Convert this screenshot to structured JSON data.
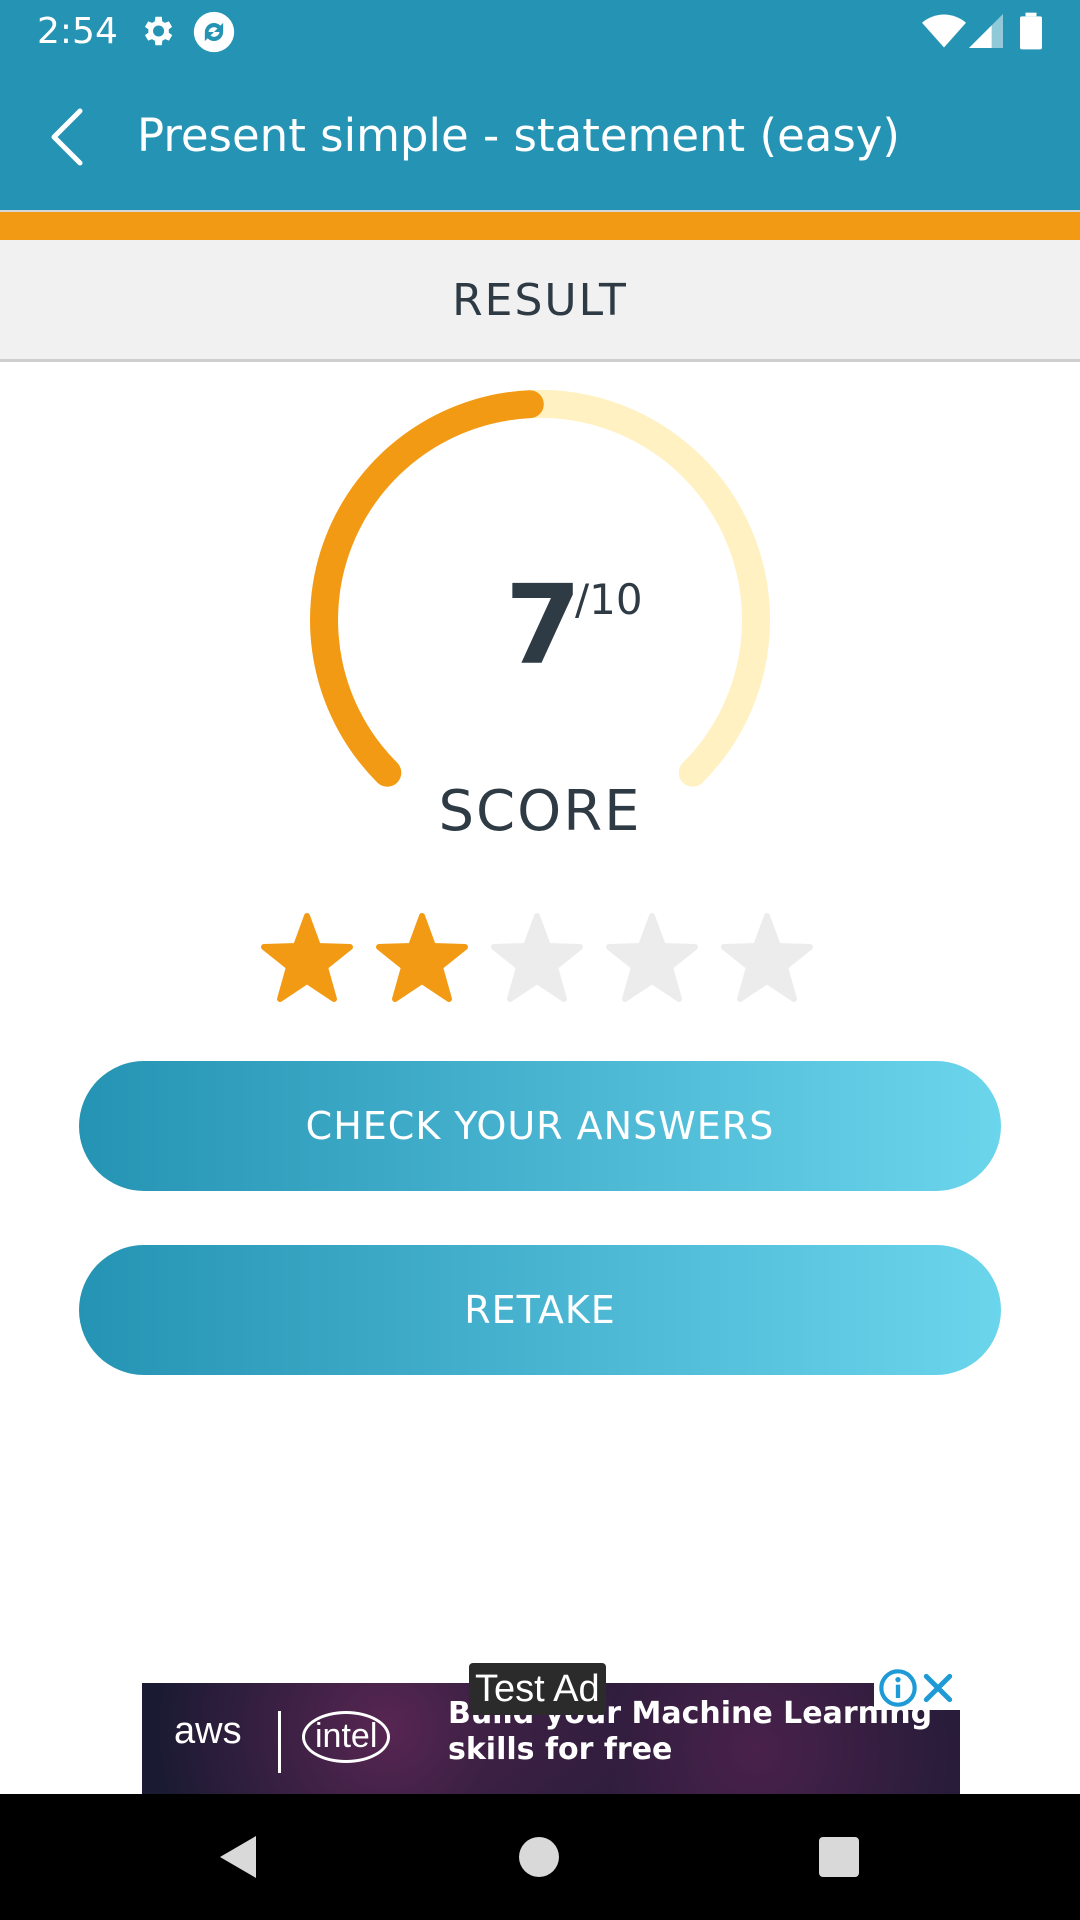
{
  "status_bar": {
    "time": "2:54",
    "icons": [
      "gear-icon",
      "sync-app-icon",
      "wifi-icon",
      "cell-signal-icon",
      "battery-icon"
    ]
  },
  "app_bar": {
    "back_icon": "chevron-left-icon",
    "title": "Present simple - statement (easy)"
  },
  "section": {
    "label": "RESULT"
  },
  "score": {
    "value": "7",
    "total": "/10",
    "label": "SCORE",
    "fraction": 0.7
  },
  "rating": {
    "filled": 2,
    "total": 5
  },
  "buttons": {
    "check_answers": "CHECK YOUR ANSWERS",
    "retake": "RETAKE"
  },
  "ad": {
    "badge": "Test Ad",
    "brand1": "aws",
    "brand2": "intel",
    "line1": "Build your Machine Learning",
    "line2": "skills for free"
  },
  "colors": {
    "primary": "#2593b3",
    "accent": "#f39a14",
    "track": "#fff1c2",
    "star_empty": "#ececec",
    "text_dark": "#2e3b45"
  }
}
